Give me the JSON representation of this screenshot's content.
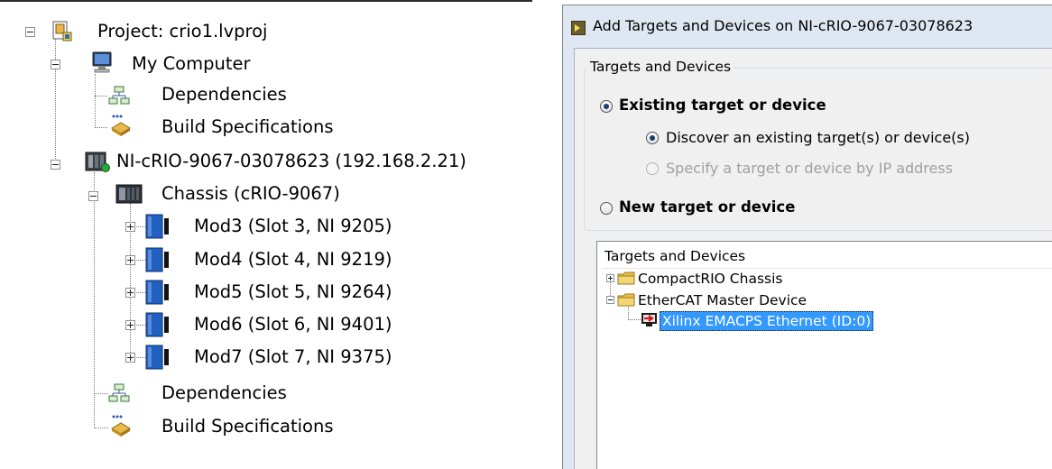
{
  "project_tree": {
    "project": "Project: crio1.lvproj",
    "my_computer": "My Computer",
    "my_computer_children": [
      "Dependencies",
      "Build Specifications"
    ],
    "target": "NI-cRIO-9067-03078623 (192.168.2.21)",
    "chassis": "Chassis (cRIO-9067)",
    "modules": [
      "Mod3 (Slot 3, NI 9205)",
      "Mod4 (Slot 4, NI 9219)",
      "Mod5 (Slot 5, NI 9264)",
      "Mod6 (Slot 6, NI 9401)",
      "Mod7 (Slot 7, NI 9375)"
    ],
    "target_children": [
      "Dependencies",
      "Build Specifications"
    ]
  },
  "dialog": {
    "title": "Add Targets and Devices on NI-cRIO-9067-03078623",
    "group_label": "Targets and Devices",
    "options": {
      "existing": "Existing target or device",
      "discover": "Discover an existing target(s) or device(s)",
      "by_ip": "Specify a target or device by IP address",
      "new": "New target or device"
    },
    "list": {
      "header": "Targets and Devices",
      "items": [
        "CompactRIO Chassis",
        "EtherCAT Master Device",
        "Xilinx EMACPS Ethernet (ID:0)"
      ]
    }
  },
  "colors": {
    "selection": "#3399ff",
    "module_blue": "#2060c0",
    "folder_yellow": "#e8c14a"
  }
}
